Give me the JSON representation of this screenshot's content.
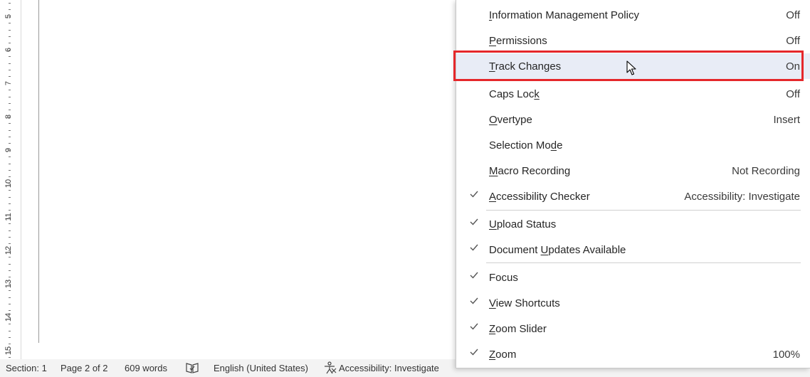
{
  "ruler": {
    "numbers": [
      "5",
      "6",
      "7",
      "8",
      "9",
      "10",
      "11",
      "12",
      "13",
      "14",
      "15"
    ]
  },
  "menu": {
    "items": [
      {
        "pre": "",
        "ul": "I",
        "post": "nformation Management Policy",
        "value": "Off",
        "checked": false
      },
      {
        "pre": "",
        "ul": "P",
        "post": "ermissions",
        "value": "Off",
        "checked": false
      },
      {
        "pre": "",
        "ul": "T",
        "post": "rack Changes",
        "value": "On",
        "checked": false
      },
      {
        "pre": "Caps Loc",
        "ul": "k",
        "post": "",
        "value": "Off",
        "checked": false
      },
      {
        "pre": "",
        "ul": "O",
        "post": "vertype",
        "value": "Insert",
        "checked": false
      },
      {
        "pre": "Selection Mo",
        "ul": "d",
        "post": "e",
        "value": "",
        "checked": false
      },
      {
        "pre": "",
        "ul": "M",
        "post": "acro Recording",
        "value": "Not Recording",
        "checked": false
      },
      {
        "pre": "",
        "ul": "A",
        "post": "ccessibility Checker",
        "value": "Accessibility: Investigate",
        "checked": true
      },
      {
        "pre": "",
        "ul": "U",
        "post": "pload Status",
        "value": "",
        "checked": true
      },
      {
        "pre": "Document ",
        "ul": "U",
        "post": "pdates Available",
        "value": "",
        "checked": true
      },
      {
        "pre": "Focus",
        "ul": "",
        "post": "",
        "value": "",
        "checked": true
      },
      {
        "pre": "",
        "ul": "V",
        "post": "iew Shortcuts",
        "value": "",
        "checked": true
      },
      {
        "pre": "",
        "ul": "Z",
        "post": "oom Slider",
        "value": "",
        "checked": true
      },
      {
        "pre": "",
        "ul": "Z",
        "post": "oom",
        "value": "100%",
        "checked": true
      }
    ]
  },
  "statusbar": {
    "section": "Section: 1",
    "page": "Page 2 of 2",
    "words": "609 words",
    "language": "English (United States)",
    "accessibility": "Accessibility: Investigate"
  },
  "colors": {
    "highlight_border": "#e5272b",
    "hover_bg": "#e8ecf6"
  }
}
